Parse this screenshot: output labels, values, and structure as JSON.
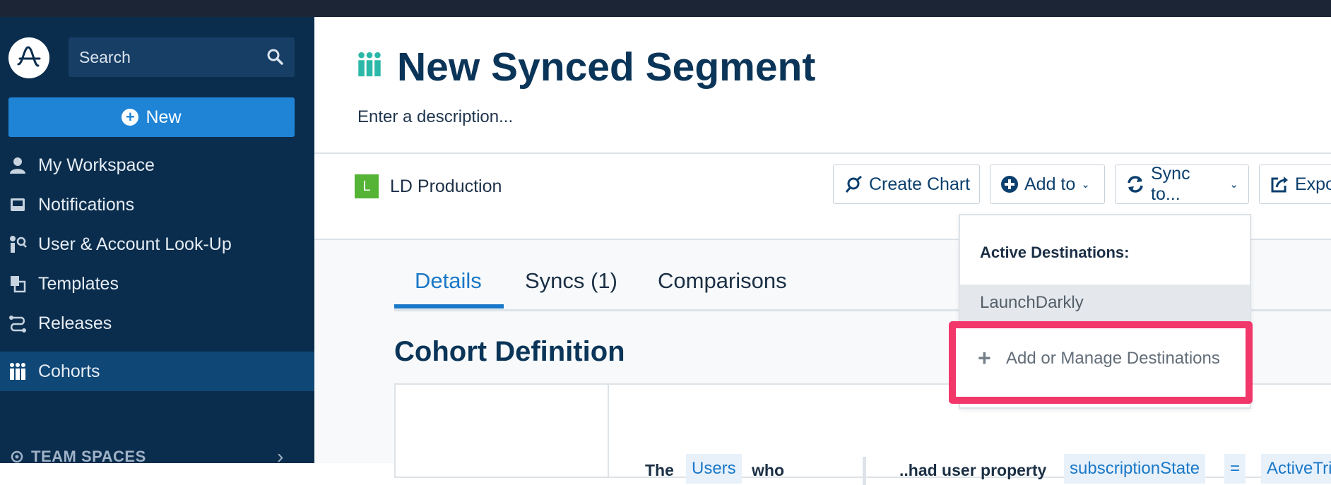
{
  "sidebar": {
    "search_label": "Search",
    "new_label": "New",
    "items": [
      {
        "label": "My Workspace",
        "icon": "user-icon"
      },
      {
        "label": "Notifications",
        "icon": "inbox-icon"
      },
      {
        "label": "User & Account Look-Up",
        "icon": "user-lookup-icon"
      },
      {
        "label": "Templates",
        "icon": "templates-icon"
      },
      {
        "label": "Releases",
        "icon": "releases-icon"
      },
      {
        "label": "Cohorts",
        "icon": "cohorts-icon",
        "active": true
      }
    ],
    "team_spaces_label": "TEAM SPACES"
  },
  "header": {
    "title": "New Synced Segment",
    "description_placeholder": "Enter a description..."
  },
  "toolbar": {
    "project_badge": "L",
    "project_name": "LD Production",
    "create_chart_label": "Create Chart",
    "add_to_label": "Add to",
    "sync_to_label": "Sync to...",
    "export_label": "Expo"
  },
  "tabs": [
    {
      "label": "Details",
      "active": true
    },
    {
      "label": "Syncs (1)"
    },
    {
      "label": "Comparisons"
    }
  ],
  "cohort": {
    "title": "Cohort Definition",
    "text_the": "The",
    "chip_users": "Users",
    "text_who": "who",
    "text_had": "..had user property",
    "chip_property": "subscriptionState",
    "chip_equals": "=",
    "chip_value": "ActiveTri"
  },
  "dropdown": {
    "header": "Active Destinations:",
    "item": "LaunchDarkly",
    "manage_label": "Add or Manage Destinations"
  },
  "colors": {
    "sidebar_bg": "#0b2d4d",
    "accent_blue": "#1f84d6",
    "highlight_pink": "#f2386b",
    "project_green": "#55b336"
  }
}
